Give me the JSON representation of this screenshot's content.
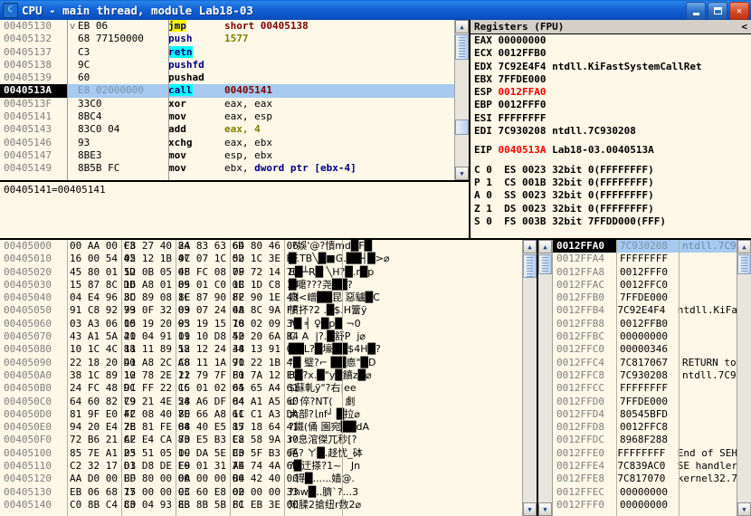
{
  "window": {
    "title": "CPU - main thread, module Lab18-03",
    "icon": "cpu-icon",
    "buttons": {
      "minimize": "minimize",
      "maximize": "maximize",
      "close": "close"
    }
  },
  "disassembly": {
    "rows": [
      {
        "address": "00405130",
        "mark": "v",
        "hex": "EB 06",
        "mnemonic": "jmp",
        "mn_hl": "yellow",
        "operand": "short 00405138",
        "selected": false
      },
      {
        "address": "00405132",
        "mark": "",
        "hex": "68 77150000",
        "mnemonic": "push",
        "mn_hl": "none",
        "operand": "1577",
        "op_style": "olive",
        "selected": false
      },
      {
        "address": "00405137",
        "mark": "",
        "hex": "C3",
        "mnemonic": "retn",
        "mn_hl": "cyan",
        "operand": "",
        "selected": false
      },
      {
        "address": "00405138",
        "mark": "",
        "hex": "9C",
        "mnemonic": "pushfd",
        "mn_hl": "none",
        "operand": "",
        "selected": false
      },
      {
        "address": "00405139",
        "mark": "",
        "hex": "60",
        "mnemonic": "pushad",
        "mn_hl": "none",
        "mn_style": "plain",
        "operand": "",
        "selected": false
      },
      {
        "address": "0040513A",
        "mark": "",
        "hex": "E8 02000000",
        "mnemonic": "call",
        "mn_hl": "cyan",
        "operand": "00405141",
        "selected": true
      },
      {
        "address": "0040513F",
        "mark": "",
        "hex": "33C0",
        "mnemonic": "xor",
        "mn_hl": "none",
        "mn_style": "plain",
        "operand": "eax, eax",
        "op_style": "plain",
        "selected": false
      },
      {
        "address": "00405141",
        "mark": "",
        "hex": "8BC4",
        "mnemonic": "mov",
        "mn_hl": "none",
        "mn_style": "plain",
        "operand": "eax, esp",
        "op_style": "plain",
        "selected": false
      },
      {
        "address": "00405143",
        "mark": "",
        "hex": "83C0 04",
        "mnemonic": "add",
        "mn_hl": "none",
        "mn_style": "plain",
        "operand": "eax, 4",
        "op_style": "num",
        "selected": false
      },
      {
        "address": "00405146",
        "mark": "",
        "hex": "93",
        "mnemonic": "xchg",
        "mn_hl": "none",
        "mn_style": "plain",
        "operand": "eax, ebx",
        "op_style": "plain",
        "selected": false
      },
      {
        "address": "00405147",
        "mark": "",
        "hex": "8BE3",
        "mnemonic": "mov",
        "mn_hl": "none",
        "mn_style": "plain",
        "operand": "esp, ebx",
        "op_style": "plain",
        "selected": false
      },
      {
        "address": "00405149",
        "mark": "",
        "hex": "8B5B FC",
        "mnemonic": "mov",
        "mn_hl": "none",
        "mn_style": "plain",
        "operand": "ebx, dword ptr [ebx-4]",
        "op_style": "ptr",
        "selected": false
      }
    ]
  },
  "info_bar": {
    "text": "00405141=00405141"
  },
  "registers": {
    "title": "Registers (FPU)",
    "collapse_glyph": "<",
    "items": [
      {
        "name": "EAX",
        "value": "00000000",
        "comment": "",
        "highlight": false
      },
      {
        "name": "ECX",
        "value": "0012FFB0",
        "comment": "",
        "highlight": false
      },
      {
        "name": "EDX",
        "value": "7C92E4F4",
        "comment": "ntdll.KiFastSystemCallRet",
        "highlight": false
      },
      {
        "name": "EBX",
        "value": "7FFDE000",
        "comment": "",
        "highlight": false
      },
      {
        "name": "ESP",
        "value": "0012FFA0",
        "comment": "",
        "highlight": true
      },
      {
        "name": "EBP",
        "value": "0012FFF0",
        "comment": "",
        "highlight": false
      },
      {
        "name": "ESI",
        "value": "FFFFFFFF",
        "comment": "",
        "highlight": false
      },
      {
        "name": "EDI",
        "value": "7C930208",
        "comment": "ntdll.7C930208",
        "highlight": false
      }
    ],
    "eip": {
      "name": "EIP",
      "value": "0040513A",
      "comment": "Lab18-03.0040513A",
      "highlight": true
    },
    "flags": [
      {
        "flag": "C",
        "bit": "0",
        "seg": "ES",
        "sel": "0023",
        "mode": "32bit",
        "base": "0(FFFFFFFF)"
      },
      {
        "flag": "P",
        "bit": "1",
        "seg": "CS",
        "sel": "001B",
        "mode": "32bit",
        "base": "0(FFFFFFFF)"
      },
      {
        "flag": "A",
        "bit": "0",
        "seg": "SS",
        "sel": "0023",
        "mode": "32bit",
        "base": "0(FFFFFFFF)"
      },
      {
        "flag": "Z",
        "bit": "1",
        "seg": "DS",
        "sel": "0023",
        "mode": "32bit",
        "base": "0(FFFFFFFF)"
      },
      {
        "flag": "S",
        "bit": "0",
        "seg": "FS",
        "sel": "003B",
        "mode": "32bit",
        "base": "7FFDD000(FFF)"
      }
    ]
  },
  "dump": {
    "rows": [
      {
        "address": "00405000",
        "b": [
          "00 AA 00 C3",
          "F8 27 40 84",
          "2A 83 63 6D",
          "64 80 46 06"
        ],
        "ascii": ".?娛'@?憒md█F█"
      },
      {
        "address": "00405010",
        "b": [
          "16 00 54 42",
          "05 12 1B 47",
          "0C 07 1C 02",
          "5D 1C 3E BF"
        ],
        "ascii": "█.TB╲█■G.██┤█>⌀"
      },
      {
        "address": "00405020",
        "b": [
          "45 80 01 1D",
          "52 0B 05 0F",
          "48 FC 08 7F",
          "09 72 14 70"
        ],
        "ascii": "E█┴R█ ╲H?█.r█p"
      },
      {
        "address": "00405030",
        "b": [
          "15 87 8C DD",
          "16 A8 01 89",
          "05 01 C0 0B",
          "1C 1D C8 19"
        ],
        "ascii": "█嚰???尧██?"
      },
      {
        "address": "00405040",
        "b": [
          "04 E4 96 3C",
          "8D 89 08 1C",
          "8E 87 90 8F",
          "F2 90 1E 43"
        ],
        "ascii": "鍘<嶒██昆 惡驢█C"
      },
      {
        "address": "00405050",
        "b": [
          "91 C8 92 79",
          "93 0F 32 03",
          "09 07 24 0A",
          "48 8C 9A FF"
        ],
        "ascii": "憤抔?2 .█$.H簹ÿ"
      },
      {
        "address": "00405060",
        "b": [
          "03 A3 06 10",
          "05 19 20 05",
          "93 19 15 70",
          "18 02 09 30"
        ],
        "ascii": "?█ ╡ ♀█p█ ¬0"
      },
      {
        "address": "00405070",
        "b": [
          "43 A1 5A 41",
          "20 04 91 11",
          "09 10 D8 42",
          "50 20 6A B4"
        ],
        "ascii": "C  A  |?.█舒P  j⌀"
      },
      {
        "address": "00405080",
        "b": [
          "10 1C 4C 88",
          "11 11 89 58",
          "12 12 24 34",
          "48 13 91 08"
        ],
        "ascii": "██L?█壕██$4H█?"
      },
      {
        "address": "00405090",
        "b": [
          "22 18 20 D0",
          "41 A8 2C A8",
          "C8 11 1A 91",
          "70 22 1B 44"
        ],
        "ascii": "\"█ 璧?⌐ ██㥁\"█D"
      },
      {
        "address": "004050A0",
        "b": [
          "38 1C 89 10",
          "12 78 2E 11",
          "22 79 7F F0",
          "81 7A 12 E0"
        ],
        "ascii": "8█?x.█\"y█饙z█⌀"
      },
      {
        "address": "004050B0",
        "b": [
          "24 FC 48 DC",
          "91 FF 22 CC",
          "15 01 02 04",
          "65 65 A4 61"
        ],
        "ascii": "$蘇軋ÿ\"?右|ee"
      },
      {
        "address": "004050C0",
        "b": [
          "64 60 82 79",
          "C9 21 4E 54",
          "28 A6 DF 04",
          "84 A1 A5 60"
        ],
        "ascii": "d`倅?NT(    劇"
      },
      {
        "address": "004050D0",
        "b": [
          "81 9F E0 42",
          "FC 08 40 7E",
          "80 66 A8 61",
          "1C C1 A3 DA"
        ],
        "ascii": "大部?㏑f┘ █拉⌀"
      },
      {
        "address": "004050E0",
        "b": [
          "94 20 E4 7E",
          "28 81 FE 04",
          "88 40 E5 85",
          "17 18 64 41"
        ],
        "ascii": "?鐵(俑 園宛██dA"
      },
      {
        "address": "004050F0",
        "b": [
          "72 B6 21 CF",
          "A2 E4 CA 83",
          "70 E5 B3 E8",
          "C2 58 9A 30"
        ],
        "ascii": "r?息涫傑兀秒[?"
      },
      {
        "address": "00405100",
        "b": [
          "85 7E A1 23",
          "05 51 05 1C",
          "09 DA 5E B3",
          "C0 5F B3 6A"
        ],
        "ascii": "厇? ㄚ█.趍忧_砵"
      },
      {
        "address": "00405110",
        "b": [
          "C2 32 17 01",
          "D3 D8 DE E0",
          "F9 01 31 7E",
          "A4 74 4A 6D"
        ],
        "ascii": "?█迀搽?1~   Jn"
      },
      {
        "address": "00405120",
        "b": [
          "AA D0 00 EF",
          "BD 80 00 00",
          "0A 00 00 00",
          "B4 42 40 00"
        ],
        "ascii": " .锝█......嫱@."
      },
      {
        "address": "00405130",
        "b": [
          "EB 06 68 77",
          "15 00 00 C3",
          "9C 60 E8 02",
          "00 00 00 33"
        ],
        "ascii": "?hw█..臍`?...3"
      },
      {
        "address": "00405140",
        "b": [
          "C0 8B C4 83",
          "C0 04 93 8B",
          "E3 8B 5B FC",
          "81 EB 3E 00"
        ],
        "ascii": "知腬2搶纽r数2⌀"
      }
    ]
  },
  "stack": {
    "rows": [
      {
        "address": "0012FFA0",
        "value": "7C930208",
        "comment": "ntdll.7C9",
        "selected": true
      },
      {
        "address": "0012FFA4",
        "value": "FFFFFFFF",
        "comment": "",
        "selected": false
      },
      {
        "address": "0012FFA8",
        "value": "0012FFF0",
        "comment": "",
        "selected": false
      },
      {
        "address": "0012FFAC",
        "value": "0012FFC0",
        "comment": "",
        "selected": false
      },
      {
        "address": "0012FFB0",
        "value": "7FFDE000",
        "comment": "",
        "selected": false
      },
      {
        "address": "0012FFB4",
        "value": "7C92E4F4",
        "comment": "ntdll.KiFa",
        "selected": false
      },
      {
        "address": "0012FFB8",
        "value": "0012FFB0",
        "comment": "",
        "selected": false
      },
      {
        "address": "0012FFBC",
        "value": "00000000",
        "comment": "",
        "selected": false
      },
      {
        "address": "0012FFC0",
        "value": "00000346",
        "comment": "",
        "selected": false
      },
      {
        "address": "0012FFC4",
        "value": "7C817067",
        "comment": "RETURN to",
        "selected": false
      },
      {
        "address": "0012FFC8",
        "value": "7C930208",
        "comment": "ntdll.7C9",
        "selected": false
      },
      {
        "address": "0012FFCC",
        "value": "FFFFFFFF",
        "comment": "",
        "selected": false
      },
      {
        "address": "0012FFD0",
        "value": "7FFDE000",
        "comment": "",
        "selected": false
      },
      {
        "address": "0012FFD4",
        "value": "80545BFD",
        "comment": "",
        "selected": false
      },
      {
        "address": "0012FFD8",
        "value": "0012FFC8",
        "comment": "",
        "selected": false
      },
      {
        "address": "0012FFDC",
        "value": "8968F288",
        "comment": "",
        "selected": false
      },
      {
        "address": "0012FFE0",
        "value": "FFFFFFFF",
        "comment": "End of SEH",
        "selected": false
      },
      {
        "address": "0012FFE4",
        "value": "7C839AC0",
        "comment": "SE handler",
        "selected": false
      },
      {
        "address": "0012FFE8",
        "value": "7C817070",
        "comment": "kernel32.7",
        "selected": false
      },
      {
        "address": "0012FFEC",
        "value": "00000000",
        "comment": "",
        "selected": false
      },
      {
        "address": "0012FFF0",
        "value": "00000000",
        "comment": "",
        "selected": false
      }
    ]
  },
  "colors": {
    "titlebar": "#1464d8",
    "pane_bg": "#fdf8e8",
    "selection": "#a6caf0",
    "register_modified": "#ff0000",
    "mnemonic": "#000080",
    "operand": "#800000",
    "address": "#808080",
    "highlight_yellow": "#ffff00",
    "highlight_cyan": "#00ffff"
  }
}
